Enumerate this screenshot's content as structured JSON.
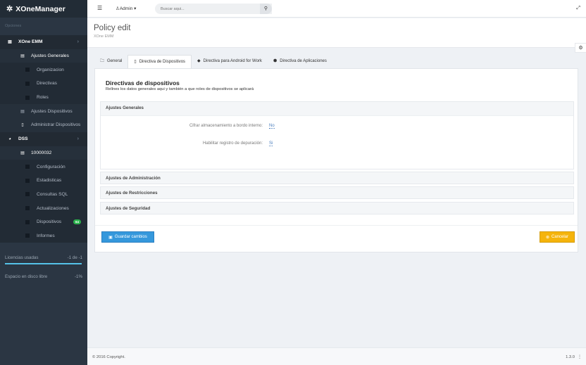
{
  "app": {
    "title": "XOneManager"
  },
  "sidebar": {
    "section_label": "Opciones",
    "items": [
      {
        "label": "XOne EMM",
        "level": "top"
      },
      {
        "label": "Ajustes Generales",
        "level": "sub"
      },
      {
        "label": "Organizacion",
        "level": "sub2"
      },
      {
        "label": "Directivas",
        "level": "sub2"
      },
      {
        "label": "Roles",
        "level": "sub2"
      },
      {
        "label": "Ajustes Dispositivos",
        "level": "sub"
      },
      {
        "label": "Administrar Dispositivos",
        "level": "sub"
      },
      {
        "label": "DSS",
        "level": "top"
      },
      {
        "label": "10000032",
        "level": "sub"
      },
      {
        "label": "Configuración",
        "level": "sub2"
      },
      {
        "label": "Estadisticas",
        "level": "sub2"
      },
      {
        "label": "Consultas SQL",
        "level": "sub2"
      },
      {
        "label": "Actualizaciones",
        "level": "sub2"
      },
      {
        "label": "Dispositivos",
        "level": "sub2",
        "badge": "64"
      },
      {
        "label": "Informes",
        "level": "sub2"
      }
    ],
    "stats": [
      {
        "label": "Licencias usadas",
        "value": "-1 de -1"
      },
      {
        "label": "Espacio en disco libre",
        "value": "-1%"
      }
    ]
  },
  "topbar": {
    "user": "Admin",
    "search_placeholder": "Buscar aqui..."
  },
  "page": {
    "title": "Policy edit",
    "subtitle": "XOne EMM"
  },
  "tabs": [
    {
      "label": "General",
      "icon": "folder-icon"
    },
    {
      "label": "Directiva de Dispositivos",
      "icon": "mobile-icon",
      "active": true
    },
    {
      "label": "Directiva para Android for Work",
      "icon": "android-icon"
    },
    {
      "label": "Directiva de Aplicaciones",
      "icon": "cubes-icon"
    }
  ],
  "card": {
    "title": "Directivas de dispositivos",
    "description": "Rellnes los datos generales aqui y también a que roles de dispositivos se aplicará",
    "panels": {
      "general": {
        "title": "Ajustes Generales",
        "fields": [
          {
            "label": "Cifrar almacenamiento a bordo interno:",
            "value": "No"
          },
          {
            "label": "Habilitar registro de depuración:",
            "value": "Si"
          }
        ]
      },
      "admin": {
        "title": "Ajustes de Administración"
      },
      "restrictions": {
        "title": "Ajustes de Restricciones"
      },
      "security": {
        "title": "Ajustes de Seguridad"
      }
    },
    "save_label": "Guardar cambios",
    "cancel_label": "Cancelar"
  },
  "footer": {
    "copyright": "© 2016 Copyright.",
    "version": "1.3.0"
  },
  "colors": {
    "sidebar_bg": "#2b3643",
    "primary": "#3598dc",
    "warning": "#f5b40c",
    "badge": "#2bb24c"
  }
}
